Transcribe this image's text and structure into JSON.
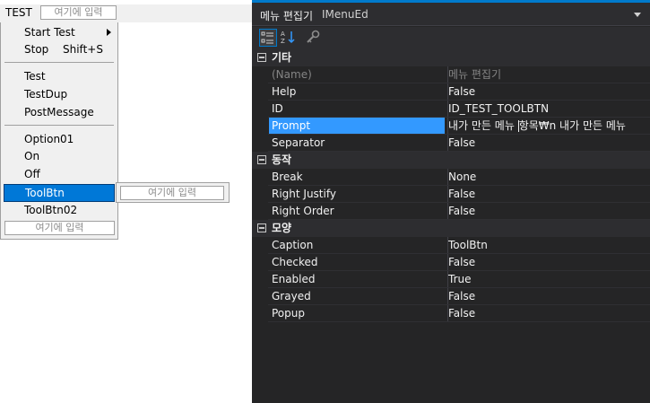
{
  "menubar": {
    "top_item": "TEST",
    "type_here": "여기에 입력"
  },
  "dropdown": {
    "items": [
      {
        "label": "Start Test",
        "has_submenu": true
      },
      {
        "label": "Stop",
        "shortcut": "Shift+S"
      },
      {
        "label": "Test"
      },
      {
        "label": "TestDup"
      },
      {
        "label": "PostMessage"
      },
      {
        "label": "Option01"
      },
      {
        "label": "On"
      },
      {
        "label": "Off"
      },
      {
        "label": "ToolBtn",
        "selected": true
      },
      {
        "label": "ToolBtn02"
      }
    ],
    "type_here": "여기에 입력"
  },
  "submenu": {
    "type_here": "여기에 입력"
  },
  "properties": {
    "title": "메뉴 편집기",
    "object": "IMenuEd",
    "categories": [
      {
        "label": "기타",
        "rows": [
          {
            "name": "(Name)",
            "value": "메뉴 편집기"
          },
          {
            "name": "Help",
            "value": "False"
          },
          {
            "name": "ID",
            "value": "ID_TEST_TOOLBTN"
          },
          {
            "name": "Prompt",
            "value_before": "내가 만든 메뉴 ",
            "value_after": "항목₩n 내가 만든 메뉴"
          },
          {
            "name": "Separator",
            "value": "False"
          }
        ]
      },
      {
        "label": "동작",
        "rows": [
          {
            "name": "Break",
            "value": "None"
          },
          {
            "name": "Right Justify",
            "value": "False"
          },
          {
            "name": "Right Order",
            "value": "False"
          }
        ]
      },
      {
        "label": "모양",
        "rows": [
          {
            "name": "Caption",
            "value": "ToolBtn"
          },
          {
            "name": "Checked",
            "value": "False"
          },
          {
            "name": "Enabled",
            "value": "True"
          },
          {
            "name": "Grayed",
            "value": "False"
          },
          {
            "name": "Popup",
            "value": "False"
          }
        ]
      }
    ]
  },
  "colors": {
    "accent": "#007acc",
    "selection": "#3399ff",
    "menu_selection": "#0078d7"
  },
  "icons": [
    "categorized-icon",
    "alphabetical-icon",
    "property-pages-icon",
    "submenu-arrow-icon",
    "dropdown-arrow-icon",
    "collapse-icon"
  ]
}
